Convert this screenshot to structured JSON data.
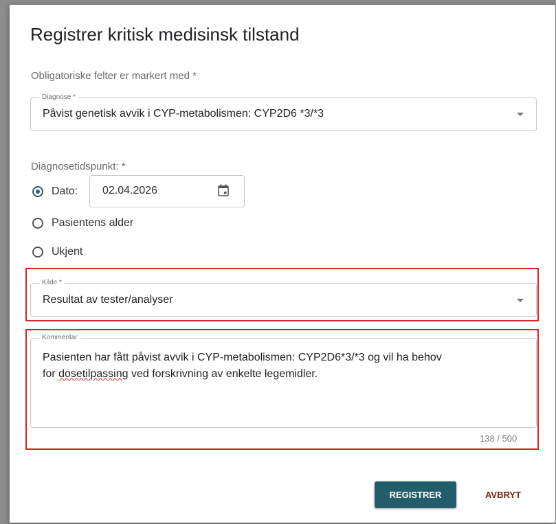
{
  "dialog": {
    "title": "Registrer kritisk medisinsk tilstand",
    "required_note": "Obligatoriske felter er markert med *"
  },
  "diagnose": {
    "label": "Diagnose *",
    "value": "Påvist genetisk avvik i CYP-metabolismen: CYP2D6 *3/*3"
  },
  "diagnosetidspunkt": {
    "label": "Diagnosetidspunkt: *",
    "options": [
      {
        "label": "Dato:",
        "checked": true
      },
      {
        "label": "Pasientens alder",
        "checked": false
      },
      {
        "label": "Ukjent",
        "checked": false
      }
    ],
    "date_value": "02.04.2026",
    "date_icon": "calendar-icon"
  },
  "kilde": {
    "label": "Kilde *",
    "value": "Resultat av tester/analyser"
  },
  "kommentar": {
    "label": "Kommentar",
    "text_line1": "Pasienten har fått påvist avvik i CYP-metabolismen: CYP2D6*3/*3 og vil ha behov",
    "text_line2_pre": "for ",
    "text_line2_misspelled": "dosetilpassing",
    "text_line2_post": " ved forskrivning av enkelte legemidler.",
    "counter": "138 / 500"
  },
  "actions": {
    "register_label": "REGISTRER",
    "cancel_label": "AVBRYT"
  },
  "colors": {
    "primary": "#235c6b",
    "cancel_text": "#7a2410",
    "highlight": "#d4262a"
  }
}
